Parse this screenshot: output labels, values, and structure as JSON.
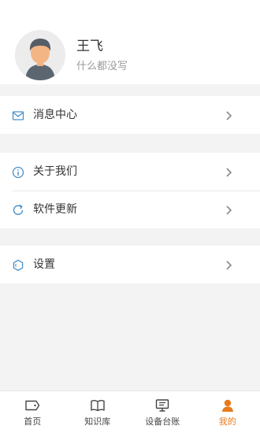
{
  "profile": {
    "name": "王飞",
    "signature": "什么都没写"
  },
  "menu_groups": [
    [
      {
        "label": "消息中心",
        "icon": "mail-icon"
      }
    ],
    [
      {
        "label": "关于我们",
        "icon": "info-icon"
      },
      {
        "label": "软件更新",
        "icon": "refresh-icon"
      }
    ],
    [
      {
        "label": "设置",
        "icon": "hexagon-settings-icon"
      }
    ]
  ],
  "tabbar": {
    "tabs": [
      {
        "label": "首页",
        "icon": "home-tag-icon",
        "active": false
      },
      {
        "label": "知识库",
        "icon": "book-icon",
        "active": false
      },
      {
        "label": "设备台账",
        "icon": "monitor-icon",
        "active": false
      },
      {
        "label": "我的",
        "icon": "person-icon",
        "active": true
      }
    ]
  },
  "colors": {
    "accent": "#e87a1c",
    "icon_blue": "#4a90c9",
    "page_bg": "#f4f3f3"
  }
}
